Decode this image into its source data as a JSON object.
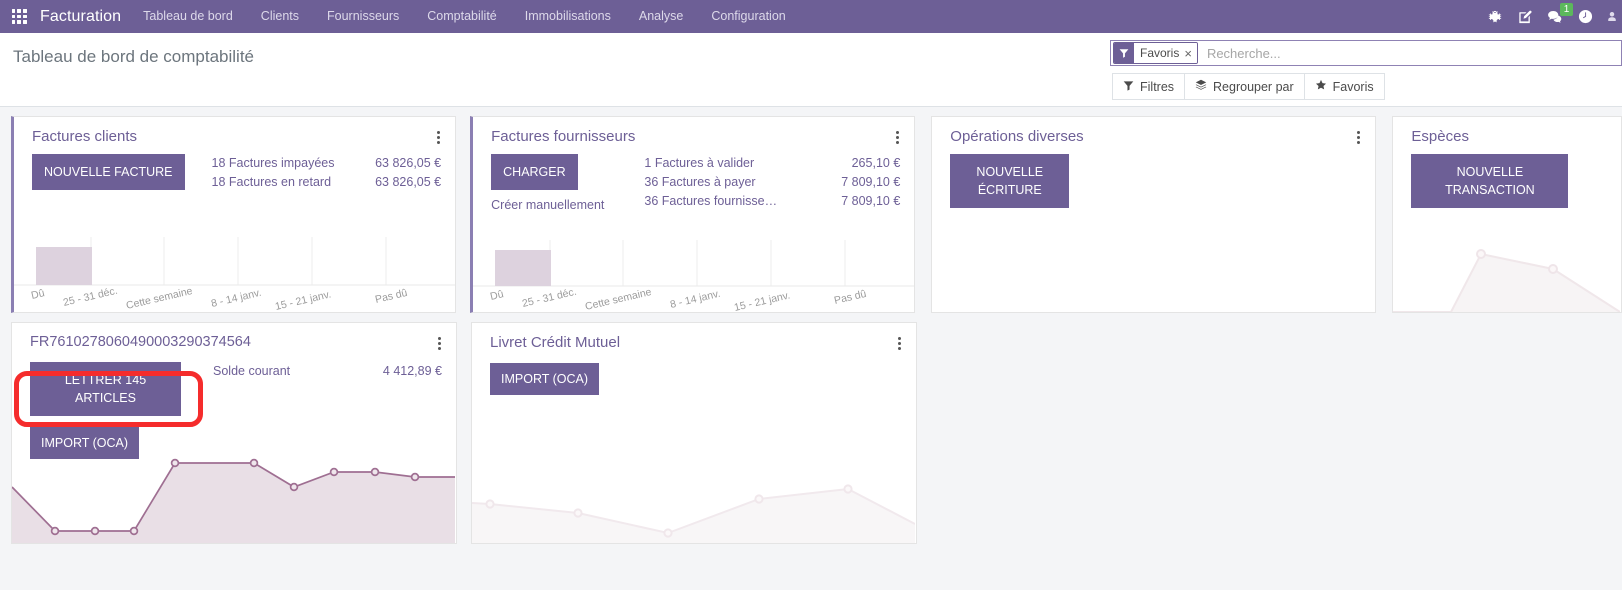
{
  "navbar": {
    "apps_icon": "grid-apps-icon",
    "brand": "Facturation",
    "menu": [
      "Tableau de bord",
      "Clients",
      "Fournisseurs",
      "Comptabilité",
      "Immobilisations",
      "Analyse",
      "Configuration"
    ],
    "icons": [
      "bug-icon",
      "compose-icon",
      "chat-icon",
      "clock-icon"
    ],
    "message_count": "1",
    "accent_color": "#6d5f96",
    "badge_color": "#5cb85c"
  },
  "control_panel": {
    "page_title": "Tableau de bord de comptabilité",
    "search": {
      "facet_label": "Favoris",
      "facet_icon": "filter-funnel-icon",
      "facet_remove": "×",
      "placeholder": "Recherche...",
      "value": ""
    },
    "buttons": [
      {
        "label": "Filtres",
        "icon": "filter-funnel-icon"
      },
      {
        "label": "Regrouper par",
        "icon": "layers-icon"
      },
      {
        "label": "Favoris",
        "icon": "star-icon"
      }
    ]
  },
  "cards": {
    "customer_invoices": {
      "title": "Factures clients",
      "button": "NOUVELLE FACTURE",
      "stats": [
        {
          "label": "18 Factures impayées",
          "value": "63 826,05 €"
        },
        {
          "label": "18 Factures en retard",
          "value": "63 826,05 €"
        }
      ]
    },
    "vendor_bills": {
      "title": "Factures fournisseurs",
      "button": "CHARGER",
      "sub_link": "Créer manuellement",
      "stats": [
        {
          "label": "1 Factures à valider",
          "value": "265,10 €"
        },
        {
          "label": "36 Factures à payer",
          "value": "7 809,10 €"
        },
        {
          "label": "36 Factures fournisse…",
          "value": "7 809,10 €"
        }
      ]
    },
    "misc_operations": {
      "title": "Opérations diverses",
      "button": "NOUVELLE ÉCRITURE"
    },
    "cash": {
      "title": "Espèces",
      "button": "NOUVELLE TRANSACTION"
    },
    "bank_iban": {
      "title": "FR7610278060490003290374564",
      "button_primary": "LETTRER 145 ARTICLES",
      "button_secondary": "IMPORT (OCA)",
      "stats": [
        {
          "label": "Solde courant",
          "value": "4 412,89 €"
        }
      ],
      "highlighted": true
    },
    "livret": {
      "title": "Livret Crédit Mutuel",
      "button": "IMPORT (OCA)"
    }
  },
  "chart_data": [
    {
      "id": "customer-invoices-bar",
      "type": "bar",
      "title": "Factures clients",
      "categories": [
        "Dû",
        "25 - 31 déc.",
        "Cette semaine",
        "8 - 14 janv.",
        "15 - 21 janv.",
        "Pas dû"
      ],
      "values": [
        63826.05,
        0,
        0,
        0,
        0,
        0
      ],
      "xlabel": "",
      "ylabel": "",
      "grid": true,
      "legend": false
    },
    {
      "id": "vendor-bills-bar",
      "type": "bar",
      "title": "Factures fournisseurs",
      "categories": [
        "Dû",
        "25 - 31 déc.",
        "Cette semaine",
        "8 - 14 janv.",
        "15 - 21 janv.",
        "Pas dû"
      ],
      "values": [
        7809.1,
        0,
        0,
        0,
        0,
        0
      ],
      "xlabel": "",
      "ylabel": "",
      "grid": true,
      "legend": false
    },
    {
      "id": "cash-line",
      "type": "area",
      "title": "Espèces",
      "x": [
        0,
        1,
        2,
        3
      ],
      "values": [
        0,
        0,
        62,
        42
      ],
      "xlabel": "",
      "ylabel": "",
      "grid": false,
      "legend": false
    },
    {
      "id": "bank-iban-line",
      "type": "area",
      "title": "FR7610278060490003290374564",
      "x": [
        0,
        1,
        2,
        3,
        4,
        5,
        6,
        7,
        8,
        9,
        10,
        11
      ],
      "values": [
        48,
        13,
        13,
        13,
        68,
        68,
        41,
        58,
        58,
        53,
        52,
        52
      ],
      "xlabel": "",
      "ylabel": "",
      "grid": false,
      "legend": false
    },
    {
      "id": "livret-line",
      "type": "area",
      "title": "Livret Crédit Mutuel",
      "x": [
        0,
        1,
        2,
        3,
        4,
        5,
        6
      ],
      "values": [
        38,
        32,
        20,
        44,
        54,
        24,
        10
      ],
      "xlabel": "",
      "ylabel": "",
      "grid": false,
      "legend": false
    }
  ]
}
